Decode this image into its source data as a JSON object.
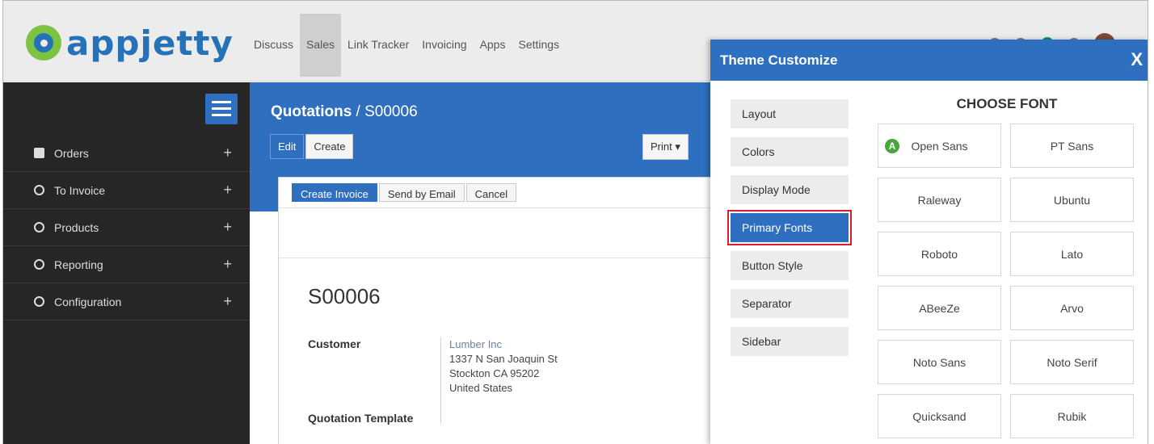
{
  "brand": {
    "name": "appjetty"
  },
  "top_menu": [
    "Discuss",
    "Sales",
    "Link Tracker",
    "Invoicing",
    "Apps",
    "Settings"
  ],
  "sidebar": {
    "items": [
      {
        "label": "Orders"
      },
      {
        "label": "To Invoice"
      },
      {
        "label": "Products"
      },
      {
        "label": "Reporting"
      },
      {
        "label": "Configuration"
      }
    ],
    "plus": "+"
  },
  "breadcrumb": {
    "section": "Quotations",
    "separator": " / ",
    "record": "S00006"
  },
  "actions": {
    "edit": "Edit",
    "create": "Create",
    "print": "Print ▾"
  },
  "sheet": {
    "buttons": {
      "create_invoice": "Create Invoice",
      "send_email": "Send by Email",
      "cancel": "Cancel"
    },
    "title": "S00006",
    "customer_label": "Customer",
    "template_label": "Quotation Template",
    "customer": {
      "name": "Lumber Inc",
      "line1": "1337 N San Joaquin St",
      "line2": "Stockton CA 95202",
      "line3": "United States"
    }
  },
  "panel": {
    "title": "Theme Customize",
    "close": "X",
    "menu": [
      "Layout",
      "Colors",
      "Display Mode",
      "Primary Fonts",
      "Button Style",
      "Separator",
      "Sidebar"
    ],
    "active_menu": "Primary Fonts",
    "heading": "CHOOSE FONT",
    "active_badge": "A",
    "fonts": [
      "Open Sans",
      "PT Sans",
      "Raleway",
      "Ubuntu",
      "Roboto",
      "Lato",
      "ABeeZe",
      "Arvo",
      "Noto Sans",
      "Noto Serif",
      "Quicksand",
      "Rubik"
    ],
    "selected_font": "Open Sans"
  },
  "colors": {
    "primary": "#2f6fc0",
    "sidebar": "#262626",
    "highlight_outline": "#d81e2c",
    "badge": "#4aa63c"
  }
}
